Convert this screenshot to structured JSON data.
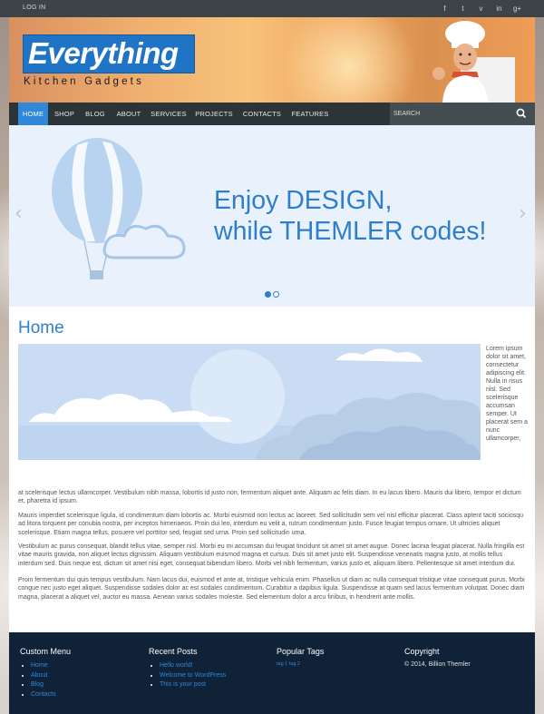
{
  "topbar": {
    "login": "LOG IN",
    "social": [
      "f",
      "t",
      "v",
      "in",
      "g+"
    ]
  },
  "header": {
    "logo": "Everything",
    "tagline": "Kitchen Gadgets"
  },
  "nav": {
    "items": [
      "HOME",
      "SHOP",
      "BLOG",
      "ABOUT",
      "SERVICES",
      "PROJECTS",
      "CONTACTS",
      "FEATURES"
    ],
    "active": "HOME",
    "search_placeholder": "SEARCH"
  },
  "slider": {
    "line1": "Enjoy DESIGN,",
    "line2": "while THEMLER codes!",
    "prev": "‹",
    "next": "›"
  },
  "content": {
    "title": "Home",
    "side_text": "Lorem ipsum dolor sit amet, consectetur adipiscing elit. Nulla in risus nisl. Sed scelerisque accumsan semper. Ut placerat sem a nunc ullamcorper,",
    "p1": "at scelerisque lectus ullamcorper. Vestibulum nibh massa, lobortis id justo non, fermentum aliquet ante. Aliquam ac felis diam. In eu lacus libero. Mauris dui libero, tempor et dictum et, pharetra id ipsum.",
    "p2": "Mauris imperdiet scelerisque ligula, id condimentum diam lobortis ac. Morbi euismod non lectus ac laoreet. Sed sollicitudin sem vel nisl efficitur placerat. Class aptent taciti sociosqu ad litora torquent per conubia nostra, per inceptos himenaeos. Proin dui leo, interdum eu velit a, rutrum condimentum justo. Fusce feugiat tempus ornare. Ut ultricies aliquet scelerisque. Etiam magna tellus, posuere vel porttitor sed, feugiat sed urna. Proin sed sollicitudin urna.",
    "p3": "Vestibulum ac purus consequat, blandit tellus vitae, semper nisl. Morbi eu mi accumsan dui feugiat tincidunt sit amet sit amet augue. Donec lacinia feugiat placerat. Nulla fringilla est vitae mauris gravida, non aliquet lectus dignissim. Aliquam vestibulum euismod magna et cursus. Duis sit amet justo elit. Suspendisse venenatis magna justo, at mollis tellus interdum sed. Duis neque est, dictum sit amet nisi eget, consequat bibendum libero. Morbi vel nibh fermentum, varius justo et, aliquam libero. Pellentesque sit amet interdum dui.",
    "p4": "Proin fermentum dui quis tempus vestibulum. Nam lacus dui, euismod et ante at, tristique vehicula enim. Phasellus ut diam ac nulla consequat tristique vitae consequat purus. Morbi congue nec justo eget aliquet. Suspendisse sodales dolor ac est sodales condimentum. Curabitur a dapibus ligula. Suspendisse at quam sed lacus fermentum volutpat. Donec diam magna, placerat a aliquet vel, auctor eu massa. Aenean varius sodales molestie. Sed elementum dolor a arcu finibus, in hendrerit ante mollis."
  },
  "footer": {
    "custom_menu": {
      "title": "Custom Menu",
      "items": [
        "Home",
        "About",
        "Blog",
        "Contacts"
      ]
    },
    "recent_posts": {
      "title": "Recent Posts",
      "items": [
        "Hello world!",
        "Welcome to WordPress",
        "This is your post"
      ]
    },
    "popular_tags": {
      "title": "Popular Tags",
      "tags": "tag 1 tag 2"
    },
    "copyright": {
      "title": "Copyright",
      "text": "© 2014, Billion Themler"
    }
  },
  "colors": {
    "accent": "#2f7ecb",
    "nav_bg": "#2d3438",
    "footer_bg": "#0f2238"
  }
}
